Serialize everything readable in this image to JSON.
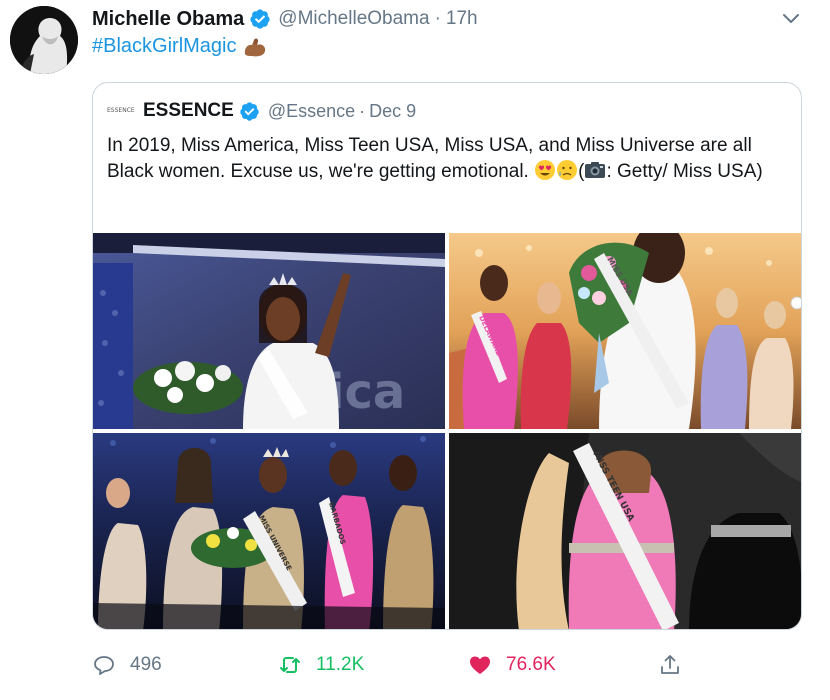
{
  "tweet": {
    "author_name": "Michelle Obama",
    "author_handle": "@MichelleObama",
    "separator": "·",
    "time": "17h",
    "text": "#BlackGirlMagic",
    "text_emoji": "flexed-biceps-medium-dark"
  },
  "quoted": {
    "logo_text": "ESSENCE",
    "name": "ESSENCE",
    "handle": "@Essence",
    "separator": "·",
    "time": "Dec 9",
    "body_before_emoji": "In 2019, Miss America, Miss Teen USA, Miss USA, and Miss Universe are all Black women. Excuse  us, we're getting emotional. ",
    "body_open_paren": "(",
    "body_after_camera": ": Getty/ Miss USA)",
    "emojis": [
      "heart-eyes-emoji",
      "crying-face-emoji",
      "camera-emoji"
    ],
    "image_texts": {
      "img1_backdrop": "ica",
      "img2_sash_left": "DELAWARE",
      "img2_sash_center": "MISS USA",
      "img3_sash_center": "MISS UNIVERSE",
      "img3_sash_right": "BARBADOS",
      "img4_sash": "MISS TEEN USA"
    }
  },
  "actions": {
    "reply_count": "496",
    "retweet_count": "11.2K",
    "like_count": "76.6K"
  },
  "colors": {
    "link": "#1b95e0",
    "verified": "#1da1f2",
    "secondary": "#657786",
    "retweet": "#17bf63",
    "like": "#e0245e"
  }
}
